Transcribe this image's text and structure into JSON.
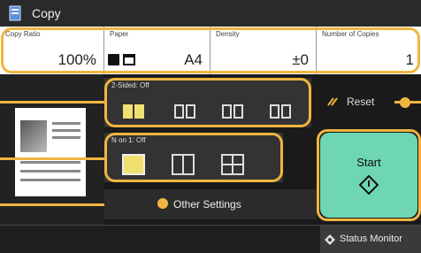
{
  "header": {
    "title": "Copy",
    "icon": "copy-icon"
  },
  "info": {
    "copy_ratio_label": "Copy Ratio",
    "copy_ratio_value": "100%",
    "paper_label": "Paper",
    "paper_value": "A4",
    "density_label": "Density",
    "density_value": "±0",
    "copies_label": "Number of Copies",
    "copies_value": "1"
  },
  "two_sided": {
    "label": "2-Sided: Off",
    "options": [
      "1-sided to 1-sided",
      "1-sided to 2-sided",
      "2-sided to 2-sided",
      "2-sided to 1-sided"
    ],
    "selected_index": 0
  },
  "n_on_1": {
    "label": "N on 1: Off",
    "options": [
      "Off",
      "2 on 1",
      "4 on 1"
    ],
    "selected_index": 0
  },
  "reset": {
    "label": "Reset"
  },
  "start": {
    "label": "Start"
  },
  "other_settings": {
    "label": "Other Settings"
  },
  "status_monitor": {
    "label": "Status Monitor"
  },
  "colors": {
    "accent": "#f2b440",
    "start": "#6fd6b4",
    "selected": "#f0e070"
  }
}
